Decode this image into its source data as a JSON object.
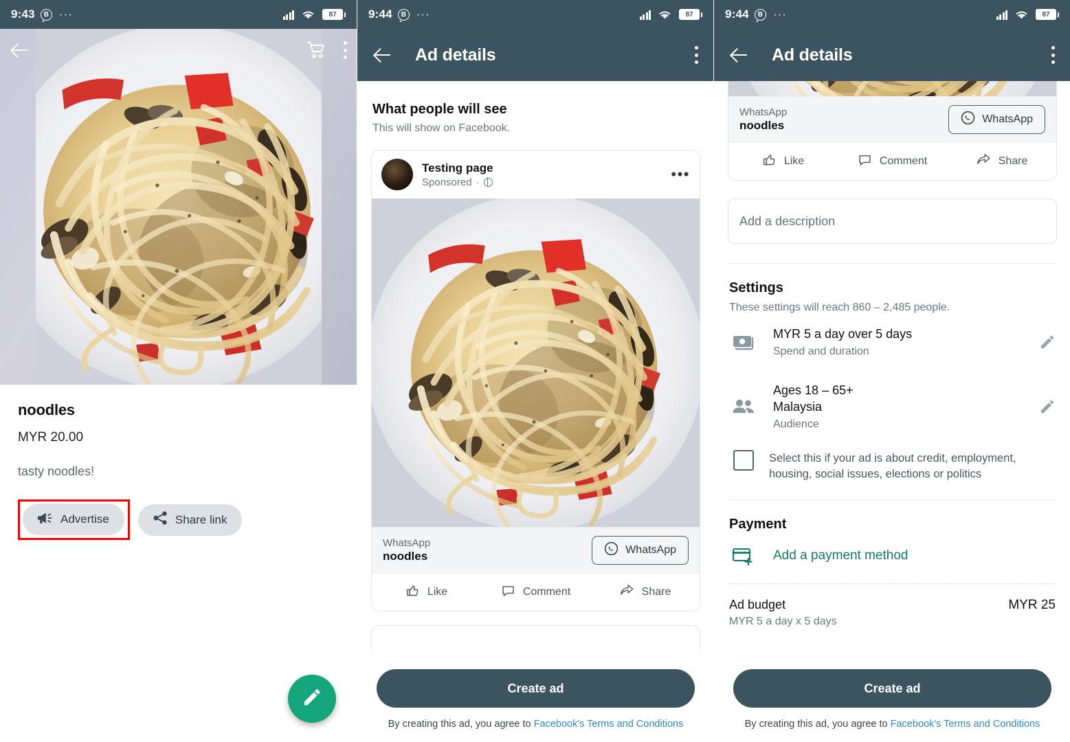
{
  "status_bar": {
    "time_panel1": "9:43",
    "time_panel2": "9:44",
    "time_panel3": "9:44",
    "badge": "B",
    "overflow_dots": "···",
    "battery": "87",
    "icons": [
      "signal-icon",
      "wifi-icon",
      "battery-icon"
    ]
  },
  "colors": {
    "header_bg": "#3c5360",
    "accent_green": "#15a77b",
    "payment_link": "#147a62",
    "terms_link": "#2e87c9",
    "highlight_red": "#ff0000",
    "pill_bg": "#dde1e5"
  },
  "panel1": {
    "back_label": "Back",
    "cart_label": "Cart",
    "menu_label": "More options",
    "title": "noodles",
    "price": "MYR 20.00",
    "description": "tasty noodles!",
    "advertise_button": "Advertise",
    "share_button": "Share link",
    "fab_label": "Edit"
  },
  "panel2": {
    "header_title": "Ad details",
    "section_title": "What people will see",
    "section_subtitle": "This will show on Facebook.",
    "post": {
      "page_name": "Testing page",
      "sponsored": "Sponsored",
      "privacy_icon": "globe-icon",
      "more_icon": "ellipsis-icon",
      "cta_label": "WhatsApp",
      "cta_title": "noodles",
      "cta_button": "WhatsApp",
      "actions": [
        {
          "label": "Like",
          "icon": "thumbs-up-icon"
        },
        {
          "label": "Comment",
          "icon": "comment-icon"
        },
        {
          "label": "Share",
          "icon": "share-arrow-icon"
        }
      ]
    },
    "footer": {
      "primary_button": "Create ad",
      "note_prefix": "By creating this ad, you agree to ",
      "note_link": "Facebook's Terms and Conditions"
    }
  },
  "panel3": {
    "header_title": "Ad details",
    "post": {
      "cta_label": "WhatsApp",
      "cta_title": "noodles",
      "cta_button": "WhatsApp",
      "actions": [
        {
          "label": "Like",
          "icon": "thumbs-up-icon"
        },
        {
          "label": "Comment",
          "icon": "comment-icon"
        },
        {
          "label": "Share",
          "icon": "share-arrow-icon"
        }
      ]
    },
    "description_placeholder": "Add a description",
    "settings": {
      "heading": "Settings",
      "subheading": "These settings will reach 860 – 2,485 people.",
      "rows": [
        {
          "icon": "money-icon",
          "title": "MYR 5 a day over 5 days",
          "subtitle": "Spend and duration",
          "edit_icon": "pencil-icon"
        },
        {
          "icon": "people-icon",
          "title_line1": "Ages 18 – 65+",
          "title_line2": "Malaysia",
          "subtitle": "Audience",
          "edit_icon": "pencil-icon"
        }
      ],
      "disclaimer_checkbox": "Select this if your ad is about credit, employment, housing, social issues, elections or politics"
    },
    "payment": {
      "heading": "Payment",
      "add_method": "Add a payment method",
      "icon": "card-add-icon"
    },
    "budget": {
      "label": "Ad budget",
      "detail": "MYR 5 a day x 5 days",
      "value": "MYR 25"
    },
    "footer": {
      "primary_button": "Create ad",
      "note_prefix": "By creating this ad, you agree to ",
      "note_link": "Facebook's Terms and Conditions"
    }
  }
}
